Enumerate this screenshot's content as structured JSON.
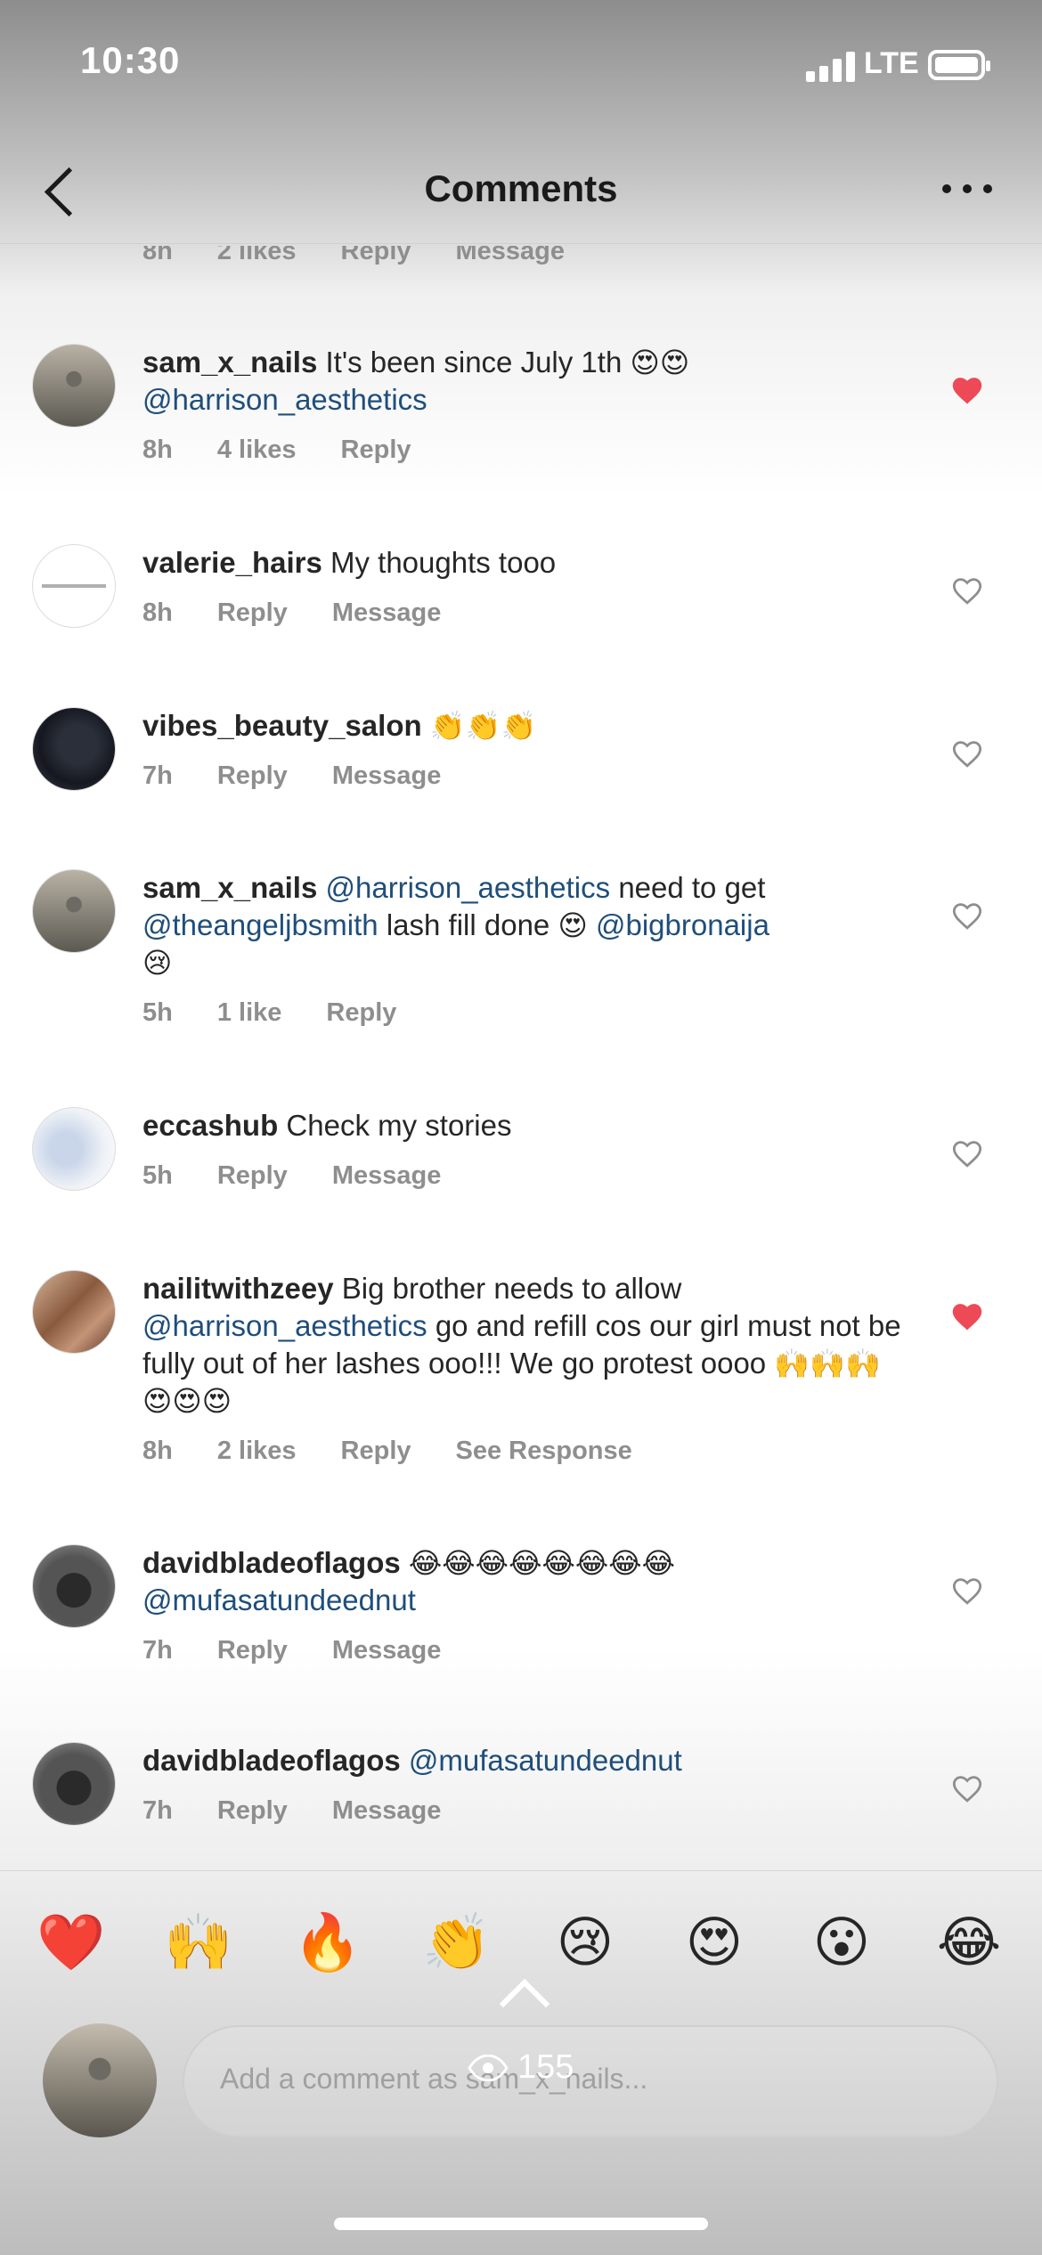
{
  "status_bar": {
    "time": "10:30",
    "network": "LTE"
  },
  "header": {
    "title": "Comments"
  },
  "top_partial_meta": {
    "time": "8h",
    "likes": "2 likes",
    "reply": "Reply",
    "message": "Message"
  },
  "comments": [
    {
      "username": "sam_x_nails",
      "text": "It's been since July 1th",
      "emoji": "😍😍",
      "mention": "@harrison_aesthetics",
      "time": "8h",
      "likes": "4 likes",
      "reply": "Reply",
      "liked": true
    },
    {
      "username": "valerie_hairs",
      "text": "My thoughts tooo",
      "time": "8h",
      "reply": "Reply",
      "message": "Message",
      "liked": false
    },
    {
      "username": "vibes_beauty_salon",
      "emoji": "👏👏👏",
      "time": "7h",
      "reply": "Reply",
      "message": "Message",
      "liked": false
    },
    {
      "username": "sam_x_nails",
      "mention1": "@harrison_aesthetics",
      "text1": "need to get",
      "mention2": "@theangeljbsmith",
      "text2": "lash fill done",
      "emoji1": "😍",
      "mention3": "@bigbronaija",
      "emoji2": "😢",
      "time": "5h",
      "likes": "1 like",
      "reply": "Reply",
      "liked": false
    },
    {
      "username": "eccashub",
      "text": "Check my stories",
      "time": "5h",
      "reply": "Reply",
      "message": "Message",
      "liked": false
    },
    {
      "username": "nailitwithzeey",
      "text1": "Big brother needs to allow",
      "mention": "@harrison_aesthetics",
      "text2": "go and refill cos our girl must not be fully out of her lashes ooo!!! We go protest oooo",
      "emoji": "🙌🙌🙌😍😍😍",
      "time": "8h",
      "likes": "2 likes",
      "reply": "Reply",
      "see_response": "See Response",
      "liked": true
    },
    {
      "username": "davidbladeoflagos",
      "emoji": "😂😂😂😂😂😂😂😂",
      "mention": "@mufasatundeednut",
      "time": "7h",
      "reply": "Reply",
      "message": "Message",
      "liked": false
    },
    {
      "username": "davidbladeoflagos",
      "mention": "@mufasatundeednut",
      "time": "7h",
      "reply": "Reply",
      "message": "Message",
      "liked": false
    }
  ],
  "emoji_bar": [
    "❤️",
    "🙌",
    "🔥",
    "👏",
    "😢",
    "😍",
    "😮",
    "😂"
  ],
  "composer": {
    "placeholder": "Add a comment as sam_x_nails..."
  },
  "views": {
    "count": "155"
  },
  "colors": {
    "heart_liked": "#ed4956",
    "mention": "#1f4e7a",
    "meta": "#8e8e8e"
  }
}
